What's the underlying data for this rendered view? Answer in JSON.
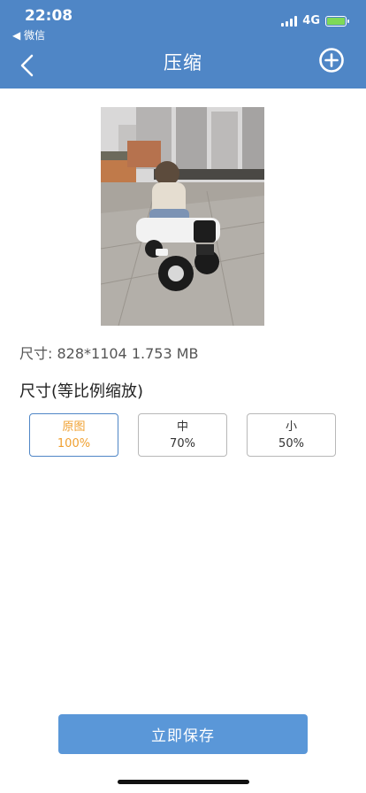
{
  "status": {
    "time": "22:08",
    "back_app": "◀ 微信",
    "network": "4G"
  },
  "header": {
    "title": "压缩"
  },
  "image": {
    "info": "尺寸: 828*1104 1.753 MB"
  },
  "scale": {
    "title": "尺寸(等比例缩放)",
    "options": [
      {
        "name": "原图",
        "percent": "100%",
        "selected": true
      },
      {
        "name": "中",
        "percent": "70%",
        "selected": false
      },
      {
        "name": "小",
        "percent": "50%",
        "selected": false
      }
    ]
  },
  "actions": {
    "save_label": "立即保存"
  },
  "colors": {
    "header": "#4f86c6",
    "save_button": "#5a97d8",
    "selected_text": "#f0a030"
  }
}
